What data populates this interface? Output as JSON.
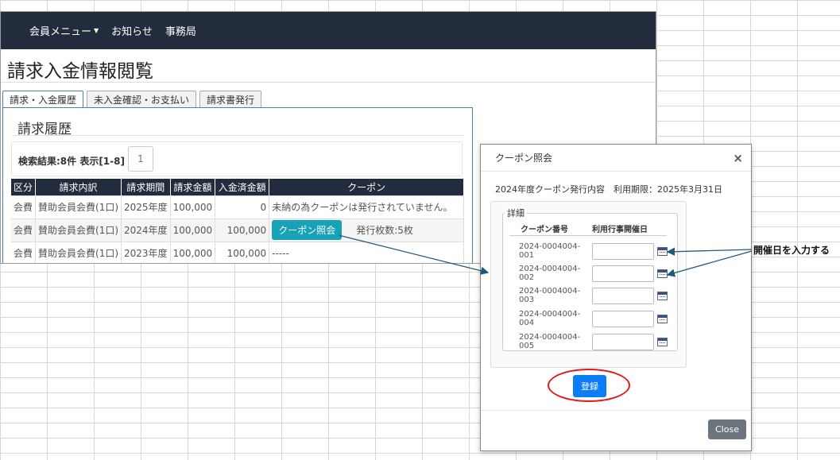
{
  "nav": {
    "items": [
      {
        "label": "会員メニュー",
        "has_caret": true
      },
      {
        "label": "お知らせ"
      },
      {
        "label": "事務局"
      }
    ]
  },
  "page_title": "請求入金情報閲覧",
  "tabs": [
    {
      "label": "請求・入金履歴",
      "active": true
    },
    {
      "label": "未入金確認・お支払い"
    },
    {
      "label": "請求書発行"
    }
  ],
  "history": {
    "section_title": "請求履歴",
    "result_text": "検索結果:8件 表示[1-8]",
    "page_number": "1",
    "columns": [
      "区分",
      "請求内訳",
      "請求期間",
      "請求金額",
      "入金済金額",
      "クーポン"
    ],
    "rows": [
      {
        "kubun": "会費",
        "detail": "賛助会員会費(1口)",
        "period": "2025年度",
        "amount": "100,000",
        "paid": "0",
        "coupon_text": "未納の為クーポンは発行されていません。"
      },
      {
        "kubun": "会費",
        "detail": "賛助会員会費(1口)",
        "period": "2024年度",
        "amount": "100,000",
        "paid": "100,000",
        "coupon_button": "クーポン照会",
        "coupon_text": "発行枚数:5枚"
      },
      {
        "kubun": "会費",
        "detail": "賛助会員会費(1口)",
        "period": "2023年度",
        "amount": "100,000",
        "paid": "100,000",
        "coupon_text": "-----"
      }
    ]
  },
  "modal": {
    "title": "クーポン照会",
    "close_symbol": "×",
    "info": "2024年度クーポン発行内容　利用期限：2025年3月31日",
    "legend": "詳細",
    "col_no": "クーポン番号",
    "col_date": "利用行事開催日",
    "coupons": [
      {
        "no": "2024-0004004-001",
        "date": ""
      },
      {
        "no": "2024-0004004-002",
        "date": ""
      },
      {
        "no": "2024-0004004-003",
        "date": ""
      },
      {
        "no": "2024-0004004-004",
        "date": ""
      },
      {
        "no": "2024-0004004-005",
        "date": ""
      }
    ],
    "register_label": "登録",
    "close_label": "Close"
  },
  "annotation": "開催日を入力する",
  "colors": {
    "navbar": "#222c3c",
    "coupon_button": "#17a2b8",
    "register_button": "#0d7df7",
    "highlight_ring": "#e01b1b",
    "arrow": "#1f5a7a"
  }
}
